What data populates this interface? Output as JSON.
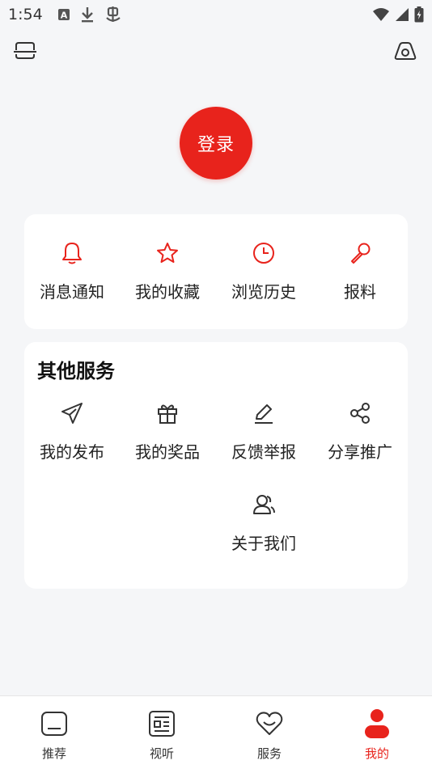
{
  "status_bar": {
    "time": "1:54",
    "left_icons": [
      "font-a-icon",
      "download-icon",
      "bug-icon"
    ],
    "right_icons": [
      "wifi-icon",
      "signal-icon",
      "battery-icon"
    ]
  },
  "top_actions": {
    "left_icon": "scan-icon",
    "right_icon": "settings-icon"
  },
  "login": {
    "label": "登录"
  },
  "quick_actions": [
    {
      "label": "消息通知",
      "icon": "bell-icon"
    },
    {
      "label": "我的收藏",
      "icon": "star-icon"
    },
    {
      "label": "浏览历史",
      "icon": "clock-icon"
    },
    {
      "label": "报料",
      "icon": "microphone-icon"
    }
  ],
  "services": {
    "title": "其他服务",
    "items": [
      {
        "label": "我的发布",
        "icon": "send-icon"
      },
      {
        "label": "我的奖品",
        "icon": "gift-icon"
      },
      {
        "label": "反馈举报",
        "icon": "edit-icon"
      },
      {
        "label": "分享推广",
        "icon": "share-icon"
      },
      {
        "label": "关于我们",
        "icon": "users-icon"
      }
    ]
  },
  "bottom_nav": [
    {
      "label": "推荐",
      "icon": "home-icon",
      "active": false
    },
    {
      "label": "视听",
      "icon": "news-icon",
      "active": false
    },
    {
      "label": "服务",
      "icon": "heart-icon",
      "active": false
    },
    {
      "label": "我的",
      "icon": "profile-icon",
      "active": true
    }
  ],
  "colors": {
    "accent": "#e8231c",
    "background": "#f5f6f8",
    "card": "#ffffff"
  }
}
